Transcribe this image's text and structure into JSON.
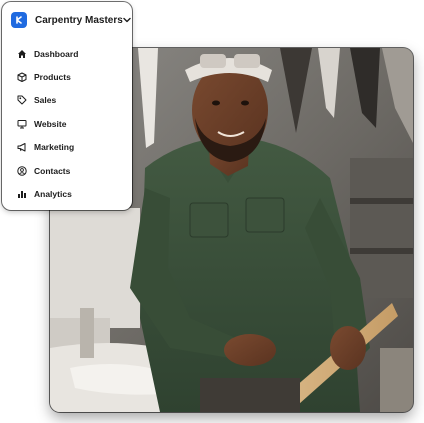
{
  "menu": {
    "brand": {
      "name": "Carpentry Masters",
      "logo_icon": "brand-logo-icon",
      "accent": "#1f6ae0"
    },
    "dropdown_icon": "chevron-down-icon",
    "items": [
      {
        "label": "Dashboard",
        "icon": "home-icon"
      },
      {
        "label": "Products",
        "icon": "box-icon"
      },
      {
        "label": "Sales",
        "icon": "tag-icon"
      },
      {
        "label": "Website",
        "icon": "monitor-icon"
      },
      {
        "label": "Marketing",
        "icon": "megaphone-icon"
      },
      {
        "label": "Contacts",
        "icon": "contact-icon"
      },
      {
        "label": "Analytics",
        "icon": "bar-chart-icon"
      }
    ]
  },
  "photo": {
    "subject": "carpenter-photo"
  }
}
